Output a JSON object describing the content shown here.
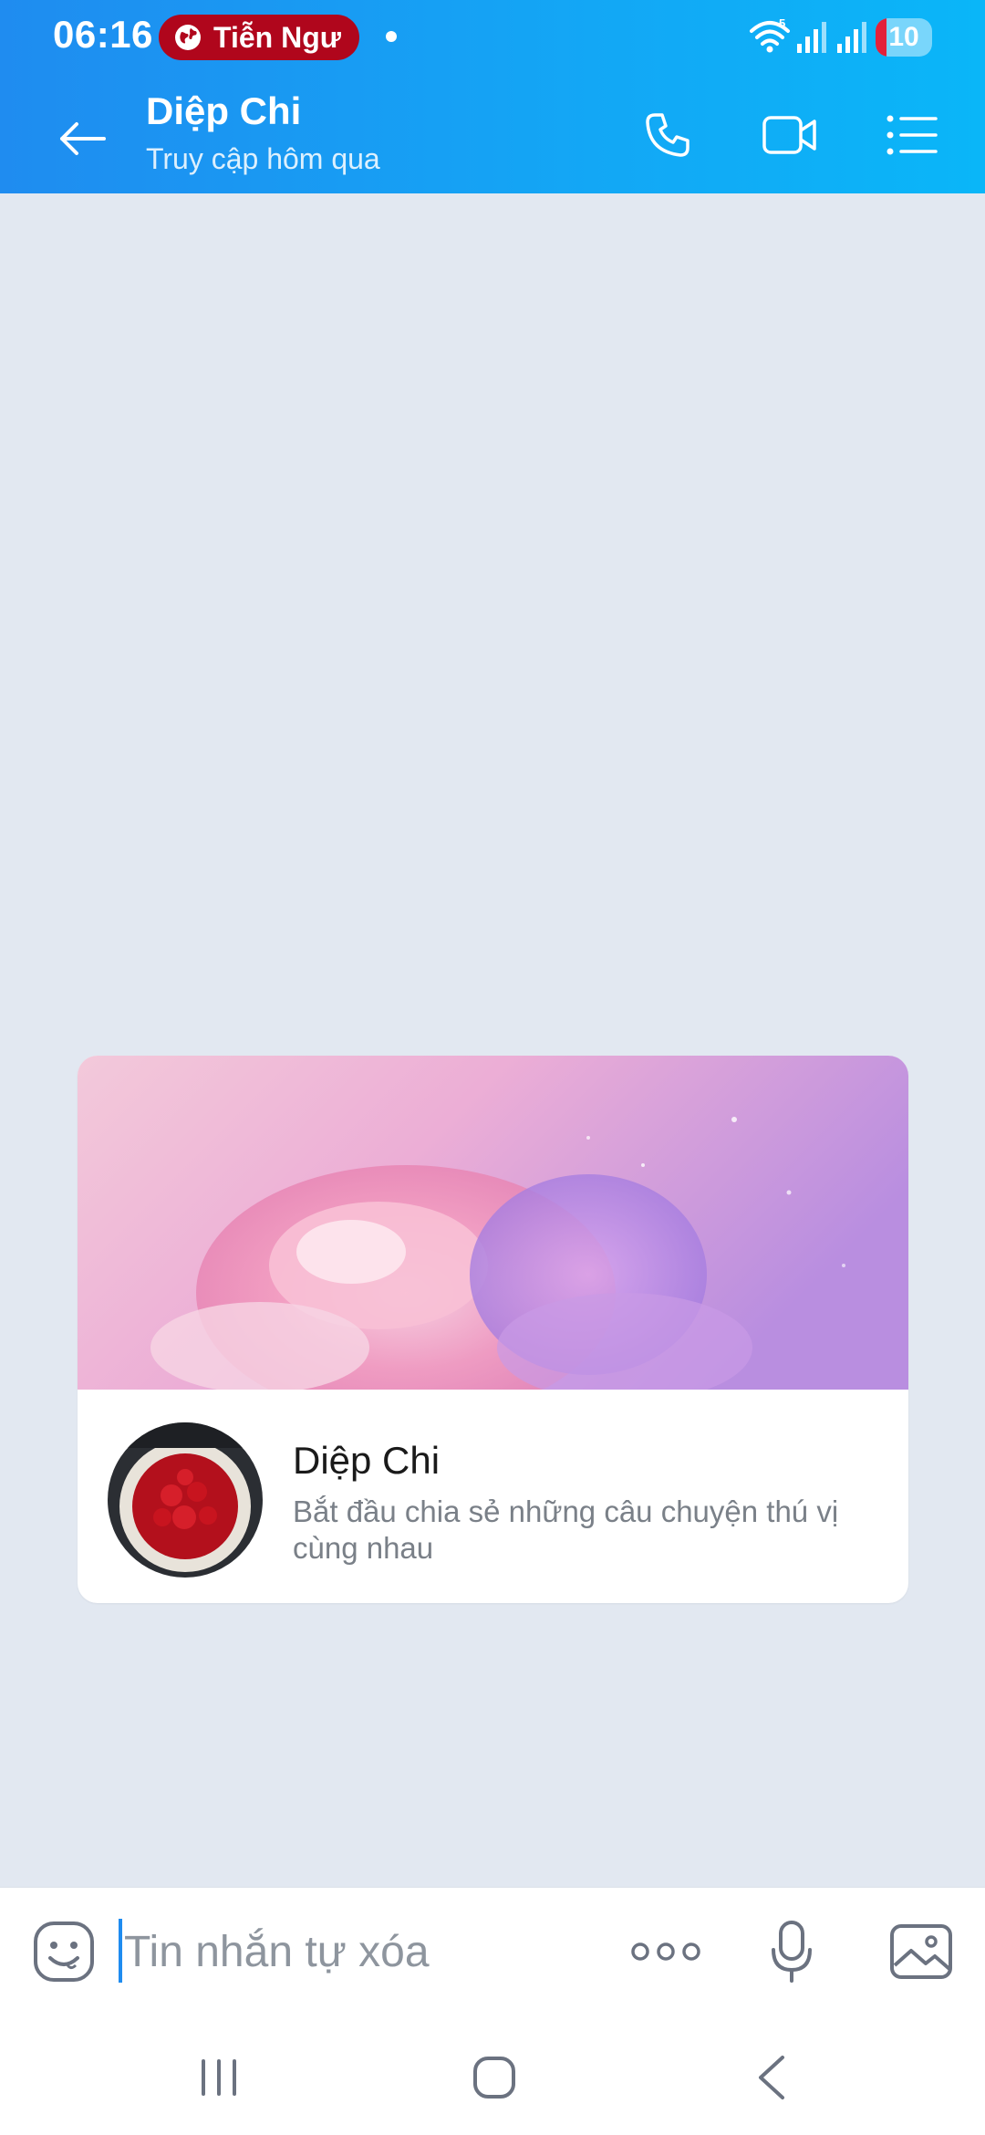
{
  "status_bar": {
    "time": "06:16",
    "notification_pill": "Tiễn Ngư",
    "battery_level": "10",
    "network_badge": "5"
  },
  "app_bar": {
    "contact_name": "Diệp Chi",
    "contact_status": "Truy cập hôm qua",
    "icons": [
      "back-arrow-icon",
      "phone-icon",
      "video-call-icon",
      "menu-list-icon"
    ]
  },
  "intro_card": {
    "name": "Diệp Chi",
    "description": "Bắt đầu chia sẻ những câu chuyện thú vị cùng nhau"
  },
  "composer": {
    "placeholder": "Tin nhắn tự xóa",
    "value": "",
    "icons": [
      "emoji-icon",
      "more-options-icon",
      "microphone-icon",
      "gallery-icon"
    ]
  },
  "nav_bar": {
    "icons": [
      "recent-apps-icon",
      "home-icon",
      "back-icon"
    ]
  },
  "colors": {
    "header_gradient_start": "#1f8cf0",
    "header_gradient_end": "#0ab6f8",
    "chat_background": "#e2e8f1",
    "notification_pill": "#b0061c",
    "accent": "#1f8cf0"
  }
}
